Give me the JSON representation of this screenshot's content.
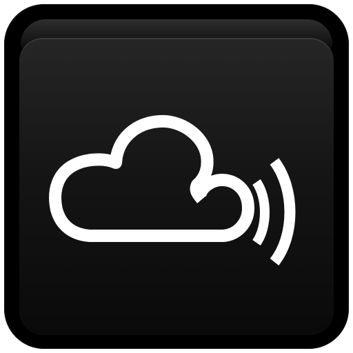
{
  "app_icon": {
    "icon": "cloud-broadcast-icon",
    "colors": {
      "frame": "#000000",
      "face_top": "#262626",
      "face_bottom": "#0a0a0a",
      "glyph": "#ffffff"
    }
  }
}
